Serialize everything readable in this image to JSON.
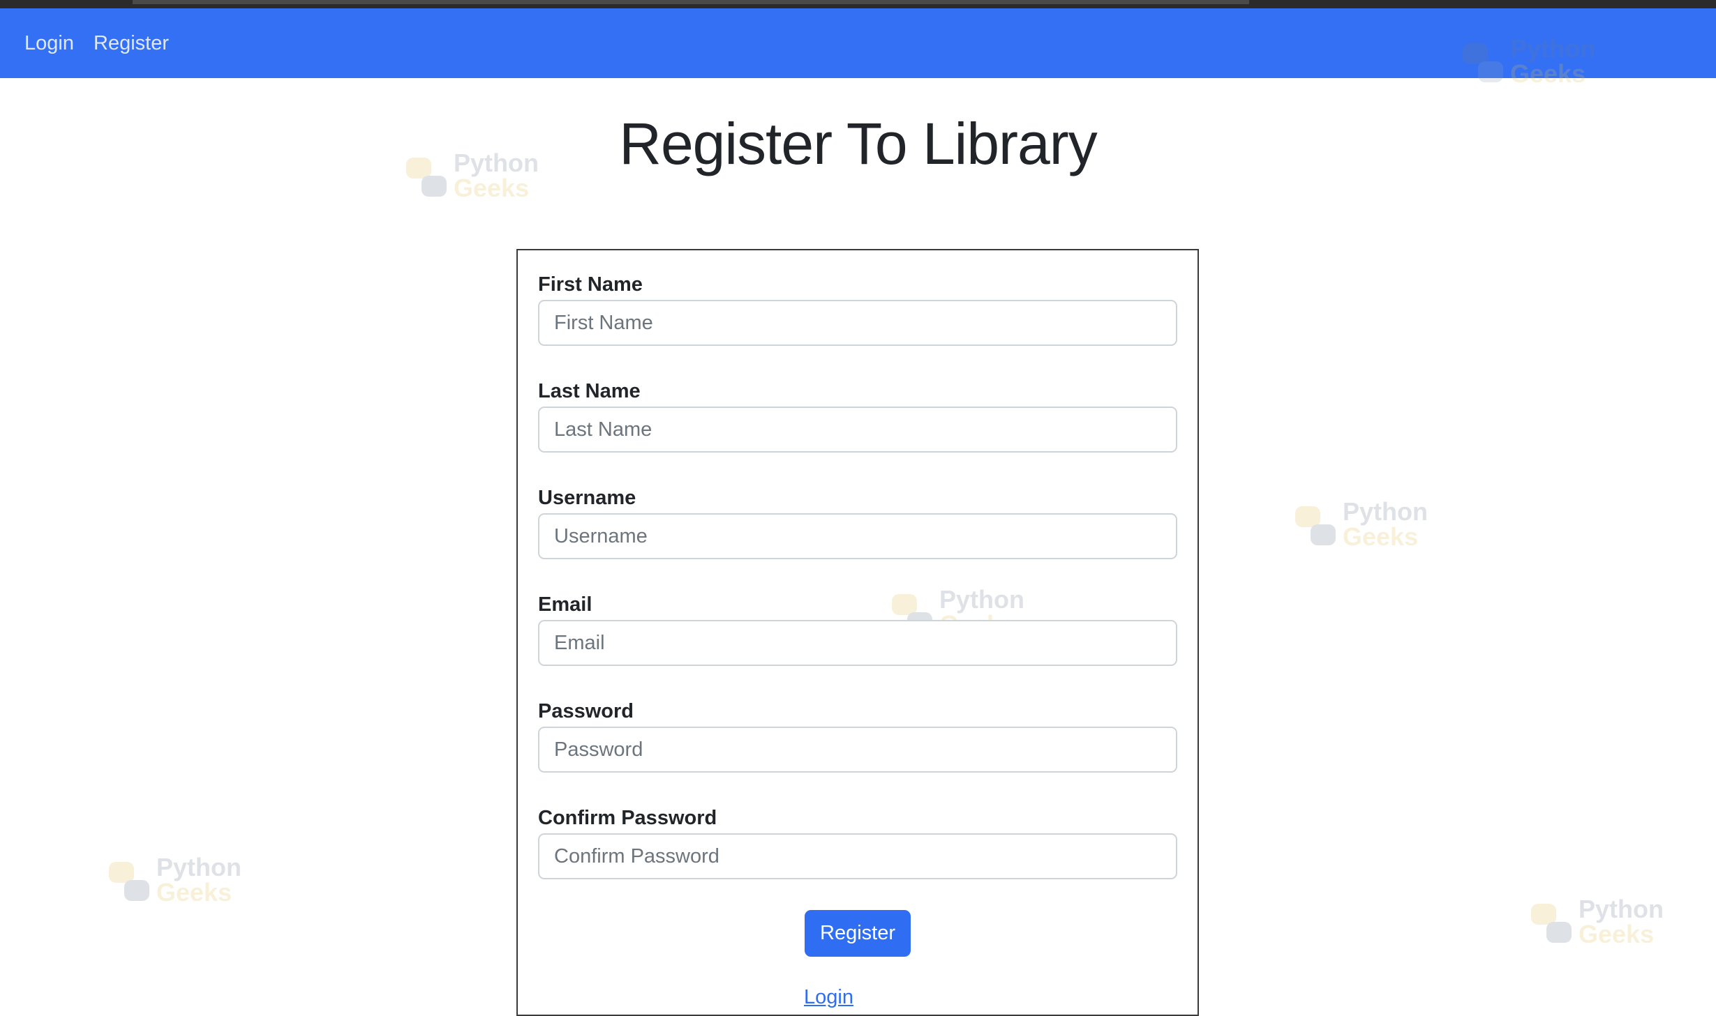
{
  "nav": {
    "login_label": "Login",
    "register_label": "Register",
    "bar_color": "#3470f4"
  },
  "page": {
    "title": "Register To Library"
  },
  "form": {
    "fields": [
      {
        "label": "First Name",
        "placeholder": "First Name"
      },
      {
        "label": "Last Name",
        "placeholder": "Last Name"
      },
      {
        "label": "Username",
        "placeholder": "Username"
      },
      {
        "label": "Email",
        "placeholder": "Email"
      },
      {
        "label": "Password",
        "placeholder": "Password"
      },
      {
        "label": "Confirm Password",
        "placeholder": "Confirm Password"
      }
    ],
    "submit_label": "Register",
    "login_link_label": "Login",
    "accent_color": "#2f6ef3"
  },
  "watermark": {
    "line1": "Python",
    "line2": "Geeks"
  }
}
